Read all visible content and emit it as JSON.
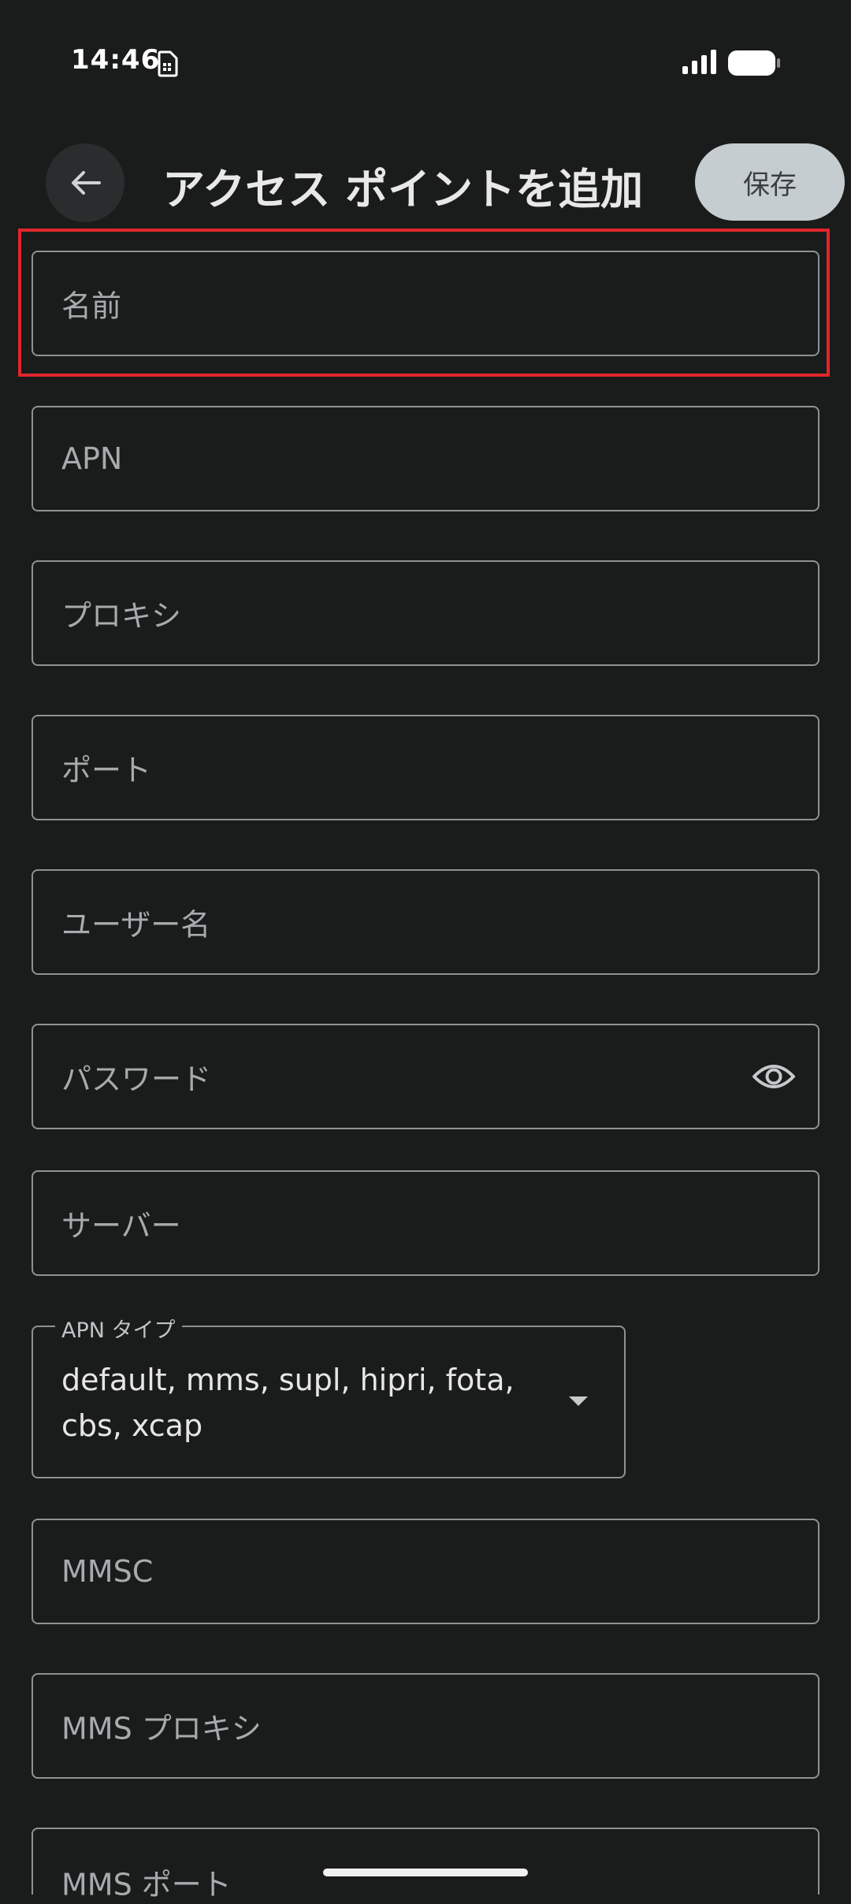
{
  "status_bar": {
    "time": "14:46"
  },
  "app_bar": {
    "title": "アクセス ポイントを追加",
    "save_label": "保存"
  },
  "form": {
    "name_placeholder": "名前",
    "apn_placeholder": "APN",
    "proxy_placeholder": "プロキシ",
    "port_placeholder": "ポート",
    "username_placeholder": "ユーザー名",
    "password_placeholder": "パスワード",
    "server_placeholder": "サーバー",
    "apn_type_label": "APN タイプ",
    "apn_type_value": "default, mms, supl, hipri, fota, cbs, xcap",
    "mmsc_placeholder": "MMSC",
    "mms_proxy_placeholder": "MMS プロキシ",
    "mms_port_placeholder": "MMS ポート"
  },
  "colors": {
    "background": "#1a1c1c",
    "save_button": "#c6cdd0",
    "highlight": "#e0262b",
    "field_border": "#8d9294"
  },
  "icons": [
    "sim-card-icon",
    "signal-icon",
    "battery-icon",
    "arrow-back-icon",
    "eye-icon",
    "dropdown-arrow-icon"
  ]
}
